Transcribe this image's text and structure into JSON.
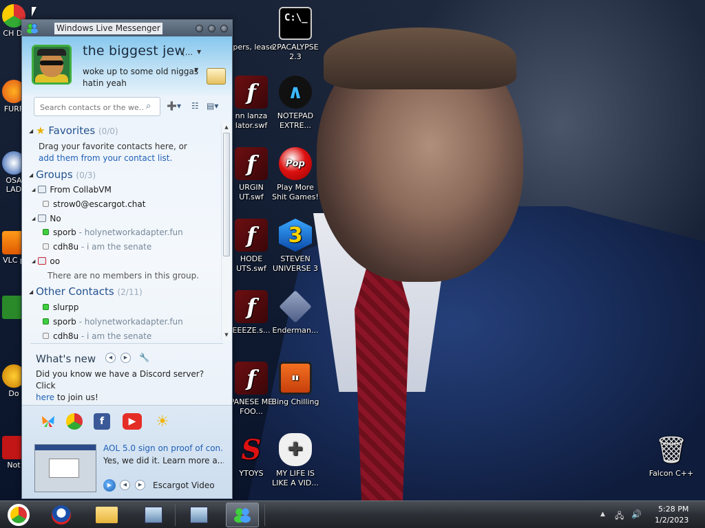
{
  "window": {
    "title": "Windows Live Messenger"
  },
  "profile": {
    "display_name": "the biggest jew",
    "name_suffix": "(...",
    "status_message": "woke up to some old niggas hatin yeah"
  },
  "search": {
    "placeholder": "Search contacts or the we..."
  },
  "favorites": {
    "label": "Favorites",
    "count": "(0/0)",
    "hint_prefix": "Drag your favorite contacts here, or",
    "hint_link": "add them from your contact list."
  },
  "groups": {
    "label": "Groups",
    "count": "(0/3)",
    "items": [
      {
        "name": "From CollabVM",
        "contacts": [
          {
            "name": "strow0@escargot.chat",
            "message": ""
          }
        ]
      },
      {
        "name": "No",
        "contacts": [
          {
            "name": "sporb",
            "message": "holynetworkadapter.fun"
          },
          {
            "name": "cdh8u",
            "message": "i am the senate"
          }
        ]
      },
      {
        "name": "oo",
        "empty_text": "There are no members in this group."
      }
    ]
  },
  "other_contacts": {
    "label": "Other Contacts",
    "count": "(2/11)",
    "contacts": [
      {
        "name": "slurpp",
        "message": ""
      },
      {
        "name": "sporb",
        "message": "holynetworkadapter.fun"
      },
      {
        "name": "cdh8u",
        "message": "i am the senate"
      }
    ]
  },
  "contact_separator": " - ",
  "whats_new": {
    "title": "What's new",
    "text_prefix": "Did you know we have a Discord server? Click",
    "link": "here",
    "text_suffix": "to join us!"
  },
  "video": {
    "title": "AOL 5.0 sign on proof of con...",
    "description": "Yes, we did it. Learn more a...",
    "source": "Escargot Video"
  },
  "desktop_icons": [
    {
      "label": "2PACALYPSE 2.3",
      "icon": "cmd-icon"
    },
    {
      "label": "NOTEPAD EXTRE...",
      "icon": "notepad-icon"
    },
    {
      "label": "Play More Shit Games!",
      "icon": "popcap-icon"
    },
    {
      "label": "STEVEN UNIVERSE 3",
      "icon": "steven-universe-icon"
    },
    {
      "label": "Enderman...",
      "icon": "enderman-icon"
    },
    {
      "label": "Bing Chilling",
      "icon": "bing-chilling-icon"
    },
    {
      "label": "MY LIFE IS LIKE A VID...",
      "icon": "gamepad-icon"
    },
    {
      "label": "Falcon C++",
      "icon": "recycle-bin-icon"
    }
  ],
  "partial_icons": [
    {
      "label": "apers, lease"
    },
    {
      "label": "nn lanza lator.swf"
    },
    {
      "label": "URGIN UT.swf"
    },
    {
      "label": "HODE UTS.swf"
    },
    {
      "label": "EEEZE.s..."
    },
    {
      "label": "PANESE ME FOO..."
    },
    {
      "label": "YTOYS"
    },
    {
      "label": "CH DI"
    },
    {
      "label": "FURF"
    },
    {
      "label": "OSA LAD"
    },
    {
      "label": "VLC p"
    },
    {
      "label": "Do"
    },
    {
      "label": "Not"
    }
  ],
  "clock": {
    "time": "5:28 PM",
    "date": "1/2/2023"
  }
}
